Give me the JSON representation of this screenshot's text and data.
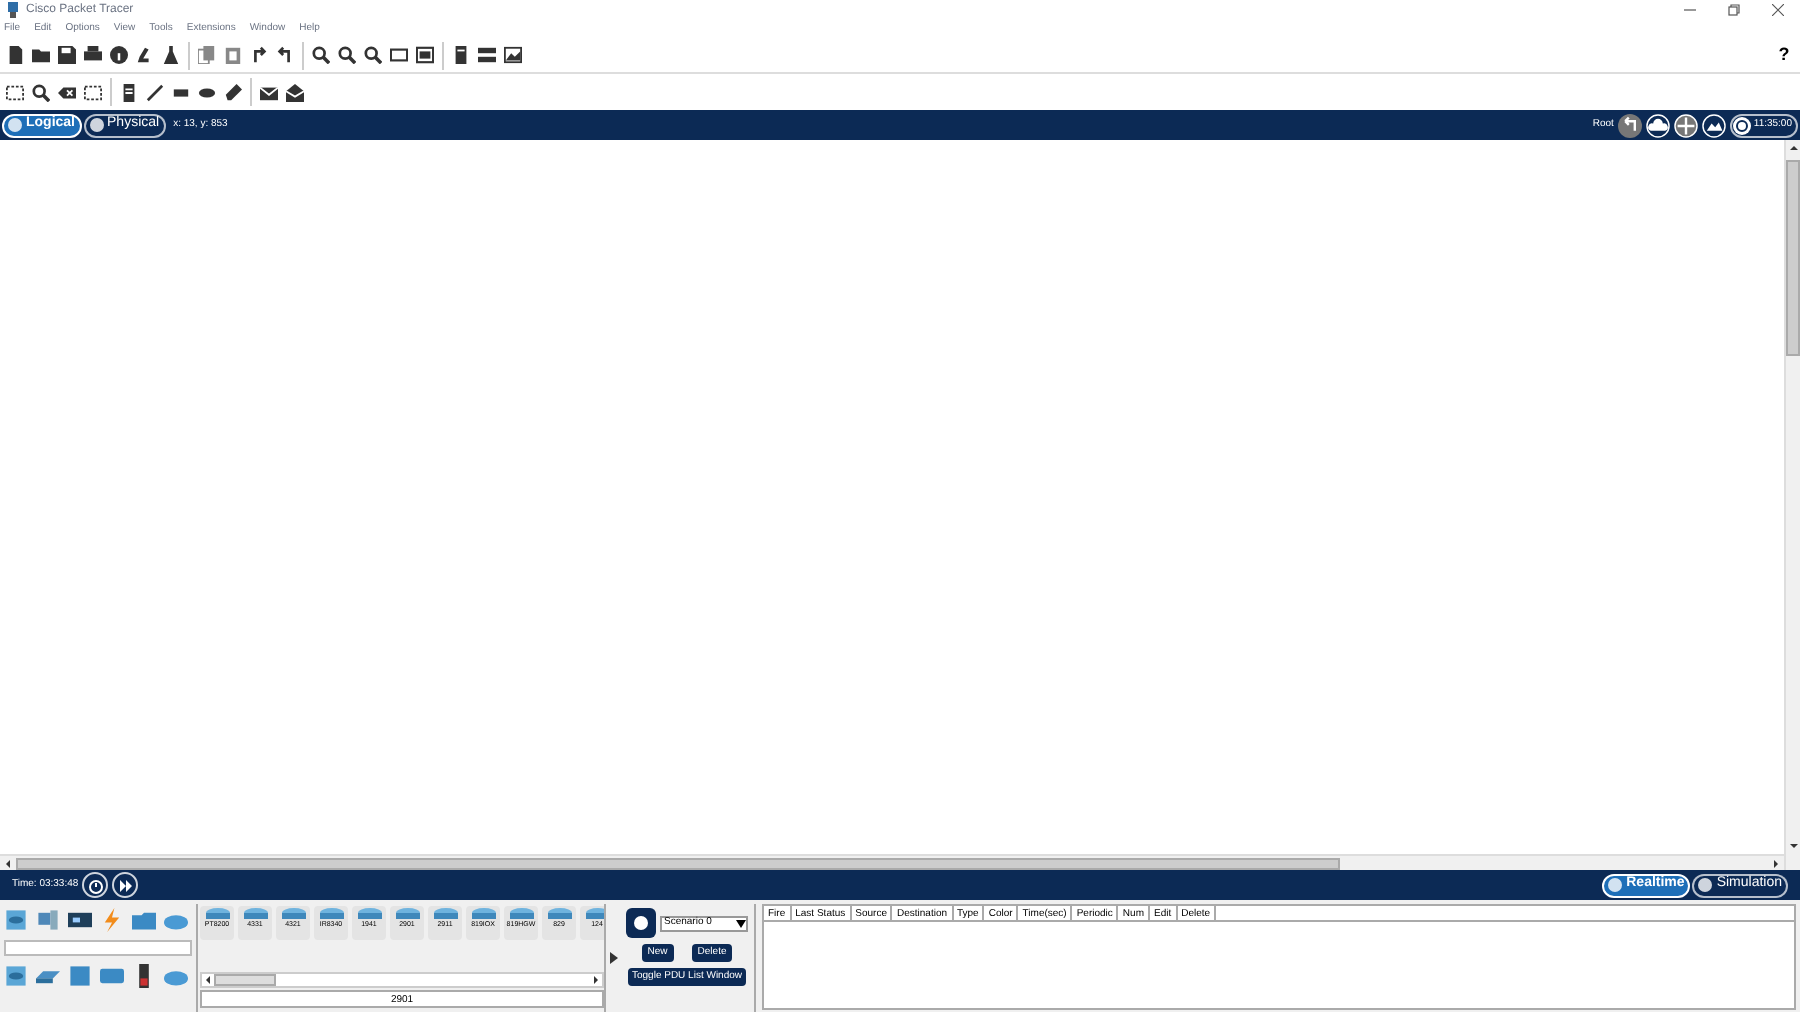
{
  "window": {
    "title": "Cisco Packet Tracer"
  },
  "menu": [
    "File",
    "Edit",
    "Options",
    "View",
    "Tools",
    "Extensions",
    "Window",
    "Help"
  ],
  "help_button": "?",
  "workspace_tabs": [
    {
      "label": "Logical",
      "selected": true
    },
    {
      "label": "Physical",
      "selected": false
    }
  ],
  "coordinates": "x: 13, y: 853",
  "root_label": "Root",
  "clock": "11:35:00",
  "time_bar": {
    "time": "Time: 03:33:48"
  },
  "mode_tabs": [
    {
      "label": "Realtime",
      "selected": true
    },
    {
      "label": "Simulation",
      "selected": false
    }
  ],
  "devices": [
    "PT8200",
    "4331",
    "4321",
    "IR8340",
    "1941",
    "2901",
    "2911",
    "819IOX",
    "819HGW",
    "829",
    "124"
  ],
  "selected_device": "2901",
  "scenario": {
    "value": "Scenario 0"
  },
  "scenario_buttons": [
    "New",
    "Delete"
  ],
  "toggle_button": "Toggle PDU List Window",
  "pdu_columns": [
    "Fire",
    "Last Status",
    "Source",
    "Destination",
    "Type",
    "Color",
    "Time(sec)",
    "Periodic",
    "Num",
    "Edit",
    "Delete"
  ]
}
